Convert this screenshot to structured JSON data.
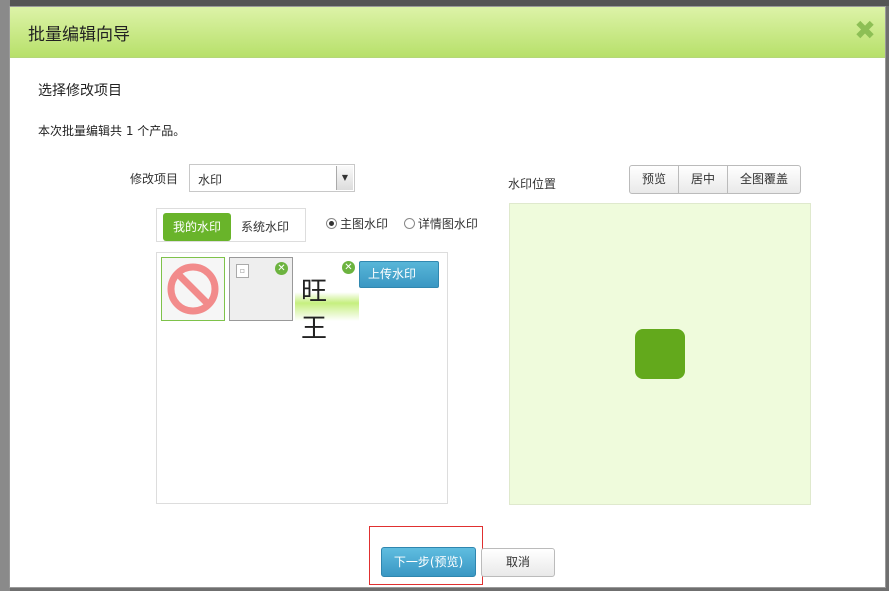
{
  "dialog": {
    "title": "批量编辑向导",
    "close_glyph": "✖",
    "section_title": "选择修改项目",
    "summary": "本次批量编辑共 1 个产品。"
  },
  "form": {
    "field_label": "修改项目",
    "selected_value": "水印"
  },
  "tabs": {
    "my": "我的水印",
    "system": "系统水印"
  },
  "radio": {
    "main": "主图水印",
    "detail": "详情图水印",
    "selected": "main"
  },
  "thumbs": {
    "wang_text": "旺王",
    "remove_glyph": "✕",
    "upload_label": "上传水印"
  },
  "position": {
    "label": "水印位置",
    "buttons": [
      "预览",
      "居中",
      "全图覆盖"
    ],
    "marker_color": "#63a91c",
    "area_color": "#effbdc"
  },
  "footer": {
    "next_label": "下一步(预览)",
    "cancel_label": "取消"
  },
  "colors": {
    "title_bar": "#c6e682",
    "accent_green": "#69b42a",
    "primary_blue": "#3a97c3"
  }
}
